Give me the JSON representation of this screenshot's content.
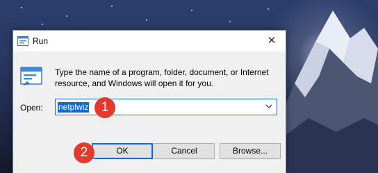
{
  "dialog": {
    "title": "Run",
    "close_glyph": "✕",
    "description": "Type the name of a program, folder, document, or Internet resource, and Windows will open it for you.",
    "open_label": "Open:",
    "open_value": "netplwiz",
    "buttons": {
      "ok": "OK",
      "cancel": "Cancel",
      "browse": "Browse..."
    }
  },
  "annotations": {
    "step1": "1",
    "step2": "2"
  },
  "colors": {
    "accent": "#0a6ed1",
    "badge": "#e23b2e"
  }
}
